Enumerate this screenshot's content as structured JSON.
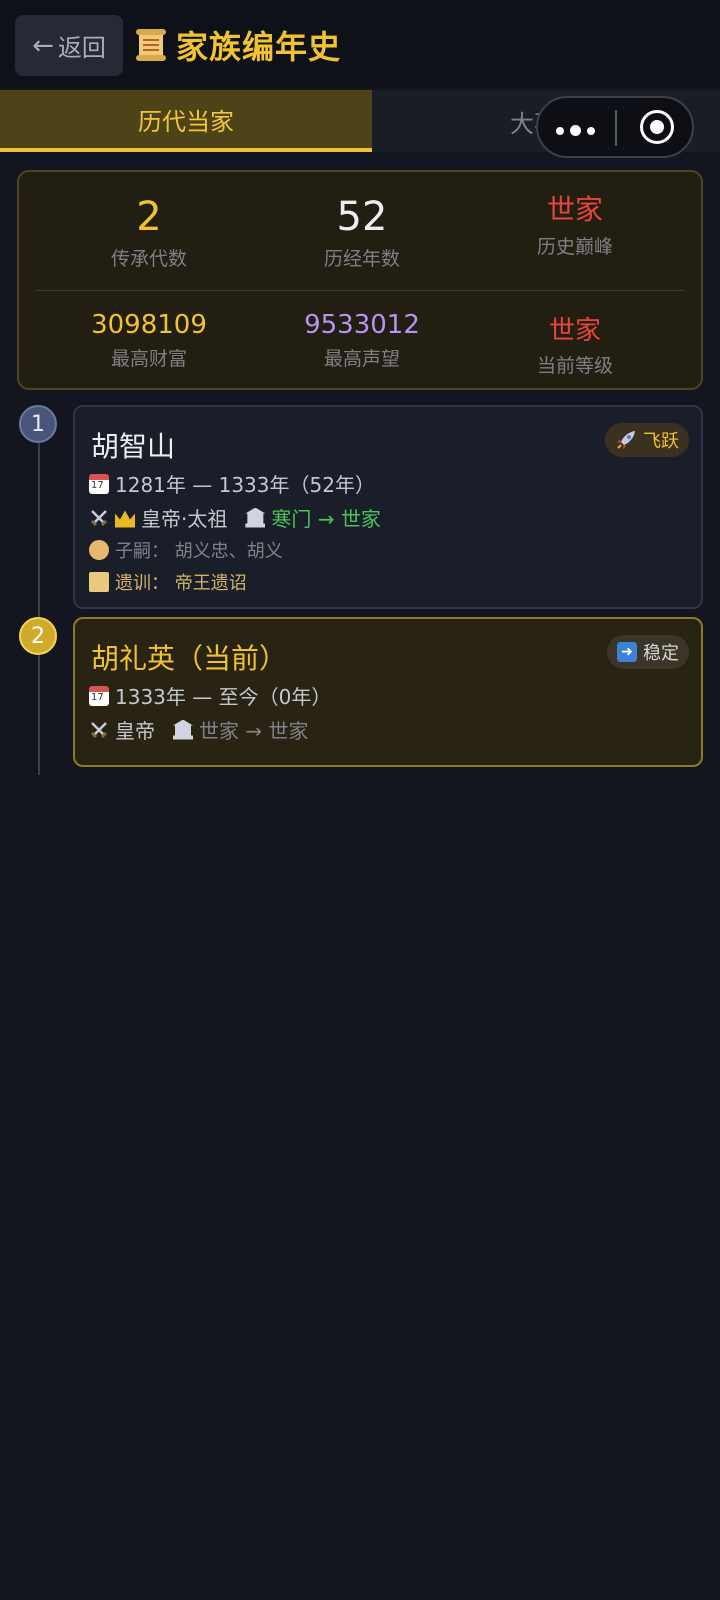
{
  "header": {
    "back_label": "返回",
    "title": "家族编年史"
  },
  "tabs": [
    {
      "label": "历代当家"
    },
    {
      "label": "大事记"
    }
  ],
  "stats": [
    {
      "value": "2",
      "label": "传承代数"
    },
    {
      "value": "52",
      "label": "历经年数"
    },
    {
      "value": "世家",
      "label": "历史巅峰"
    },
    {
      "value": "3098109",
      "label": "最高财富"
    },
    {
      "value": "9533012",
      "label": "最高声望"
    },
    {
      "value": "世家",
      "label": "当前等级"
    }
  ],
  "heads": [
    {
      "index": "1",
      "name": "胡智山",
      "badge": "飞跃",
      "period": "1281年 — 1333年（52年）",
      "titles": "皇帝·太祖",
      "rank_change": "寒门 → 世家",
      "heirs": "子嗣：  胡义忠、胡义",
      "legacy": "遗训：  帝王遗诏"
    },
    {
      "index": "2",
      "name": "胡礼英（当前）",
      "badge": "稳定",
      "period": "1333年 — 至今（0年）",
      "titles": "皇帝",
      "rank_change": "世家 → 世家"
    }
  ],
  "colors": {
    "accent": "#f1c232",
    "green": "#4cc35a",
    "red": "#e8453c",
    "purple": "#b892f2"
  }
}
